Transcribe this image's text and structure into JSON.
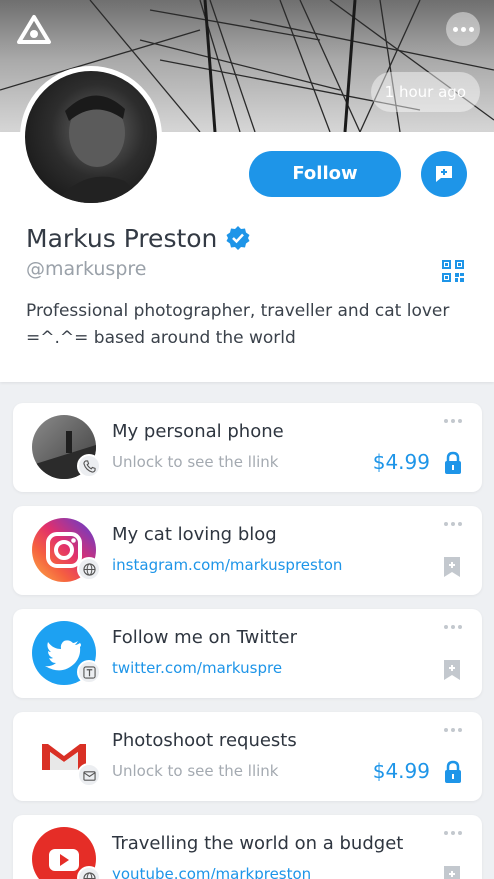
{
  "header": {
    "logo_icon": "app-logo-icon",
    "more_icon": "more-horizontal-icon",
    "time_label": "1 hour ago"
  },
  "profile": {
    "name": "Markus Preston",
    "verified_icon": "verified-badge-icon",
    "handle": "@markuspre",
    "bio": "Professional photographer, traveller and cat lover =^.^= based around the world",
    "follow_label": "Follow",
    "message_icon": "message-plus-icon",
    "qr_icon": "qr-code-icon"
  },
  "colors": {
    "accent": "#1e95e8",
    "text_dark": "#2f3640",
    "text_muted": "#a4aab1",
    "background": "#eef0f3"
  },
  "links": [
    {
      "title": "My personal phone",
      "subtitle": "Unlock to see the llink",
      "price": "$4.99",
      "locked": true,
      "thumb_icon": "photo-thumbnail",
      "badge_icon": "phone-icon"
    },
    {
      "title": "My cat loving blog",
      "subtitle": "instagram.com/markuspreston",
      "locked": false,
      "thumb_icon": "instagram-icon",
      "badge_icon": "globe-icon"
    },
    {
      "title": "Follow me on Twitter",
      "subtitle": "twitter.com/markuspre",
      "locked": false,
      "thumb_icon": "twitter-icon",
      "badge_icon": "text-icon"
    },
    {
      "title": "Photoshoot requests",
      "subtitle": "Unlock to see the llink",
      "price": "$4.99",
      "locked": true,
      "thumb_icon": "gmail-icon",
      "badge_icon": "mail-icon"
    },
    {
      "title": "Travelling the world on a budget",
      "subtitle": "youtube.com/markpreston",
      "locked": false,
      "thumb_icon": "youtube-icon",
      "badge_icon": "globe-icon"
    }
  ]
}
